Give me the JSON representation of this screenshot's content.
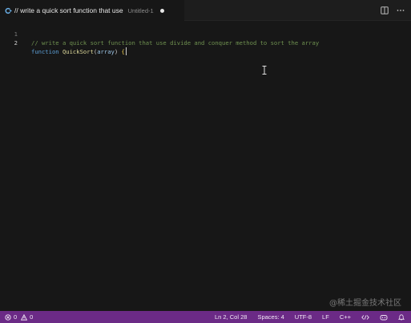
{
  "tab": {
    "title": "// write a quick sort function that use",
    "description": "Untitled-1",
    "icon": "cpp-file-icon"
  },
  "editor": {
    "lines": [
      {
        "number": "1",
        "comment": "// write a quick sort function that use divide and conquer method to sort the array"
      },
      {
        "number": "2",
        "keyword": "function",
        "name": "QuickSort",
        "open_paren": "(",
        "param": "array",
        "close_paren": ")",
        "brace": "{"
      }
    ]
  },
  "watermark": "@稀土掘金技术社区",
  "statusbar": {
    "errors": "0",
    "warnings": "0",
    "position": "Ln 2, Col 28",
    "spaces": "Spaces: 4",
    "encoding": "UTF-8",
    "eol": "LF",
    "language": "C++",
    "color": "#6b2a86"
  }
}
